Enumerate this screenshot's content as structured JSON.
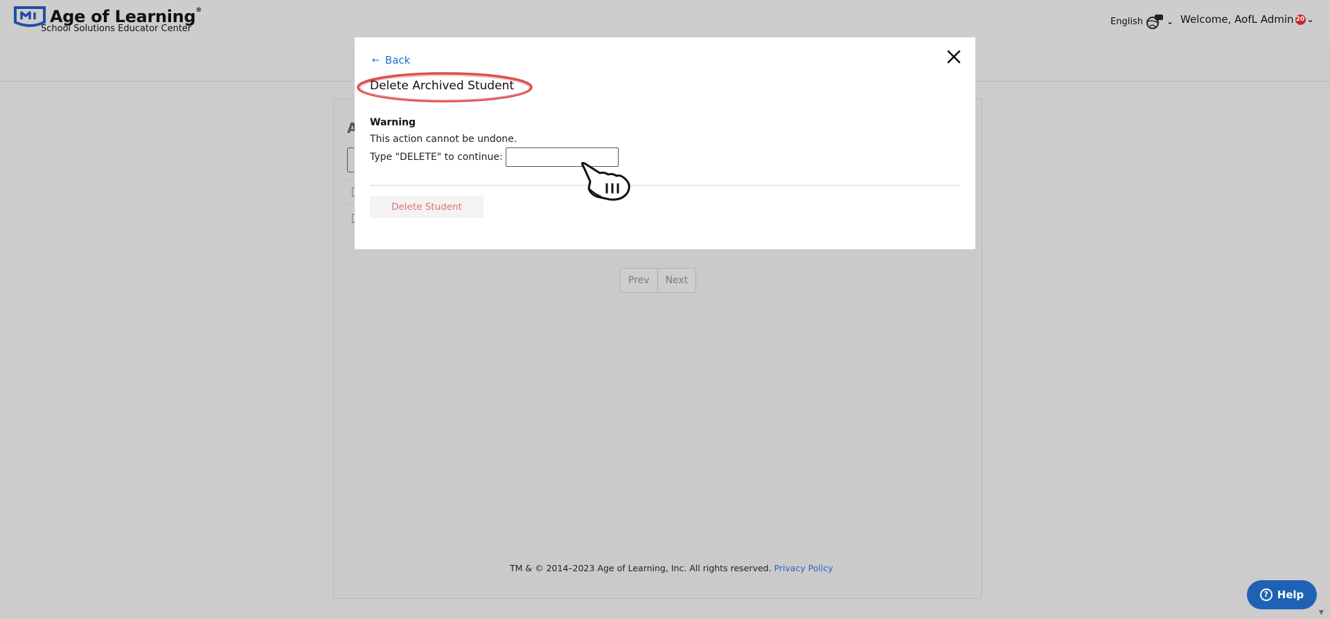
{
  "header": {
    "brand_title": "Age of Learning",
    "brand_tm": "®",
    "brand_subtitle": "School Solutions Educator Center",
    "language_label": "English",
    "welcome_text": "Welcome, AofL Admin",
    "notification_count": "20"
  },
  "background_page": {
    "heading_fragment": "A",
    "pagination": {
      "prev_label": "Prev",
      "next_label": "Next"
    }
  },
  "footer": {
    "copyright": "TM & © 2014–2023 Age of Learning, Inc. All rights reserved.",
    "privacy_link": "Privacy Policy"
  },
  "help_button": {
    "label": "Help",
    "icon": "question-circle-icon"
  },
  "modal": {
    "back_label": "Back",
    "title": "Delete Archived Student",
    "warning_heading": "Warning",
    "warning_text": "This action cannot be undone.",
    "confirm_label": "Type \"DELETE\" to continue:",
    "confirm_value": "",
    "delete_button_label": "Delete Student"
  },
  "colors": {
    "accent_link": "#1f6fd0",
    "danger_text": "#e0706b",
    "help_button": "#1f62b5",
    "annotation": "#d32f2f",
    "brand": "#1f4fa8"
  }
}
